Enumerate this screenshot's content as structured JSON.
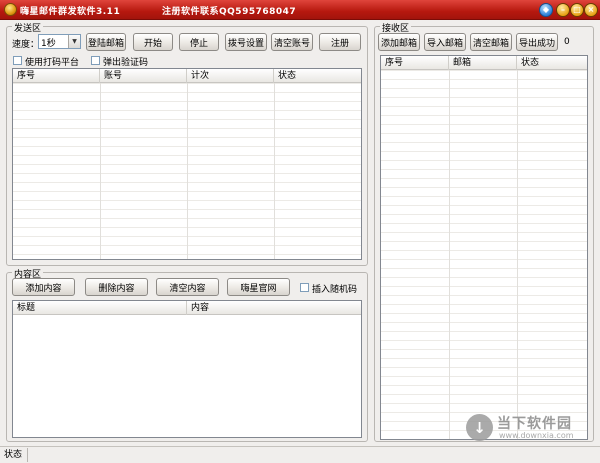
{
  "window": {
    "title": "嗨星邮件群发软件3.11",
    "registration": "注册软件联系QQ595768047",
    "controls": {
      "gem_icon": "gem-icon",
      "minimize_icon": "minimize-icon",
      "maximize_icon": "maximize-icon",
      "close_icon": "close-icon"
    },
    "accent_color": "#b6180f"
  },
  "send_area": {
    "legend": "发送区",
    "speed_label": "速度：",
    "speed_value": "1秒",
    "buttons": {
      "login_mailbox": "登陆邮箱",
      "start": "开始",
      "stop": "停止",
      "dial_settings": "拨号设置",
      "clear_accounts": "清空账号",
      "register": "注册"
    },
    "checkboxes": {
      "use_captcha_platform": "使用打码平台",
      "popup_captcha": "弹出验证码"
    },
    "table": {
      "columns": [
        "序号",
        "账号",
        "计次",
        "状态"
      ],
      "rows": []
    }
  },
  "receive_area": {
    "legend": "接收区",
    "buttons": {
      "add_mailbox": "添加邮箱",
      "import_mailbox": "导入邮箱",
      "clear_mailbox": "清空邮箱",
      "export_success": "导出成功"
    },
    "count": "0",
    "table": {
      "columns": [
        "序号",
        "邮箱",
        "状态"
      ],
      "rows": []
    }
  },
  "content_area": {
    "legend": "内容区",
    "buttons": {
      "add_content": "添加内容",
      "delete_content": "删除内容",
      "clear_content": "清空内容",
      "official_site": "嗨星官网"
    },
    "checkbox_random_code": "插入随机码",
    "table": {
      "columns": [
        "标题",
        "内容"
      ],
      "rows": []
    }
  },
  "statusbar": {
    "label": "状态"
  },
  "watermark": {
    "name": "当下软件园",
    "url": "www.downxia.com"
  }
}
